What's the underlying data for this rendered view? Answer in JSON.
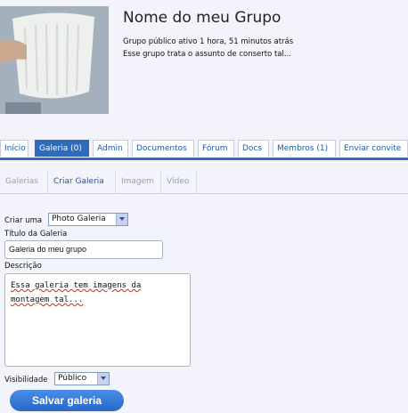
{
  "group": {
    "name": "Nome do meu Grupo",
    "status": "Grupo público ativo 1 hora, 51 minutos atrás",
    "description": "Esse grupo trata o assunto de conserto tal..."
  },
  "tabs": [
    {
      "label": "Início"
    },
    {
      "label": "Galeria (0)"
    },
    {
      "label": "Admin"
    },
    {
      "label": "Documentos"
    },
    {
      "label": "Fórum"
    },
    {
      "label": "Docs"
    },
    {
      "label": "Membros (1)"
    },
    {
      "label": "Enviar convite"
    }
  ],
  "subtabs": [
    {
      "label": "Galerias"
    },
    {
      "label": "Criar Galeria"
    },
    {
      "label": "Imagem"
    },
    {
      "label": "Vídeo"
    }
  ],
  "form": {
    "type_label": "Criar uma",
    "type_value": "Photo Galeria",
    "title_label": "Título da Galeria",
    "title_value": "Galeria do meu grupo",
    "desc_label": "Descrição",
    "desc_line1": "Essa galeria tem imagens da",
    "desc_line2": "montagem tal...",
    "visibility_label": "Visibilidade",
    "visibility_value": "Público",
    "save_label": "Salvar galeria"
  },
  "colors": {
    "accent": "#2d6bbf",
    "link": "#1a5aa8",
    "background": "#f2f3fb"
  }
}
